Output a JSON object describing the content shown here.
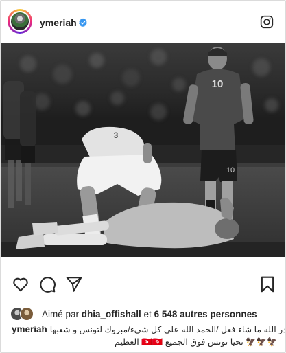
{
  "post": {
    "username": "ymeriah",
    "verified": true,
    "brand_icon": "instagram-icon"
  },
  "photo": {
    "description_icon": "football-photo",
    "players": [
      {
        "number": "10"
      },
      {
        "number": "10"
      },
      {
        "number": "3"
      },
      {
        "number": "10"
      }
    ]
  },
  "actions": {
    "like_icon": "heart-icon",
    "comment_icon": "comment-icon",
    "share_icon": "send-icon",
    "save_icon": "bookmark-icon"
  },
  "likes": {
    "prefix": "Aimé par ",
    "user": "dhia_offishall",
    "middle": " et ",
    "count": "6 548 autres personnes"
  },
  "caption": {
    "username": "ymeriah",
    "line1": "قدر الله ما شاء فعل /الحمد الله على كل شيء/مبروك لتونس و شعبها",
    "line2": "🦅🦅🦅 تحيا تونس فوق الجميع 🇹🇳🇹🇳 العظيم"
  },
  "colors": {
    "verified": "#3897f0",
    "text": "#262626",
    "border": "#dbdbdb"
  }
}
